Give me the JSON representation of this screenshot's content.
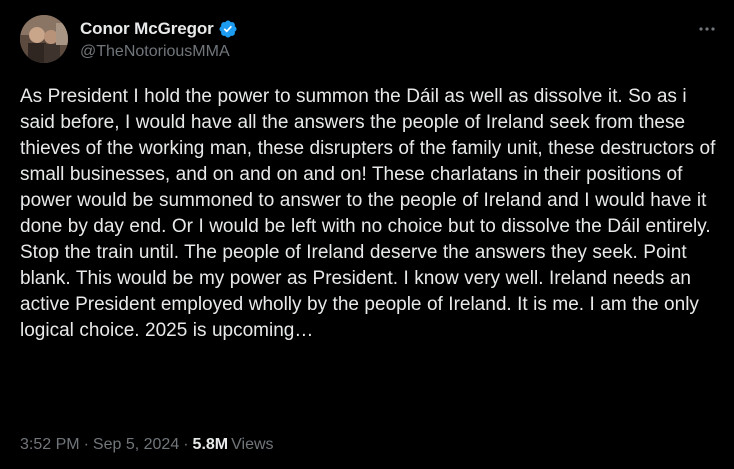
{
  "author": {
    "display_name": "Conor McGregor",
    "handle": "@TheNotoriousMMA",
    "verified": true
  },
  "tweet": {
    "text": "As President I hold the power to summon the Dáil as well as dissolve it. So as i said before, I would have all the answers the people of Ireland seek from these thieves of the working man, these disrupters of the family unit, these destructors of small businesses, and on and on and on! These charlatans in their positions of power would be summoned to answer to the people of Ireland and I would have it done by day end. Or I would be left with no choice but to dissolve the Dáil entirely. Stop the train until. The people of Ireland deserve the answers they seek. Point blank. This would be my power as President. I know very well. Ireland needs an active President employed wholly by the people of Ireland. It is me. I am the only logical choice. 2025 is upcoming…"
  },
  "meta": {
    "time": "3:52 PM",
    "separator": "·",
    "date": "Sep 5, 2024",
    "view_count": "5.8M",
    "views_label": "Views"
  },
  "icons": {
    "verified": "verified-badge-icon",
    "more": "more-options-icon"
  },
  "colors": {
    "background": "#000000",
    "text_primary": "#e7e9ea",
    "text_secondary": "#71767b",
    "verified_blue": "#1d9bf0"
  }
}
